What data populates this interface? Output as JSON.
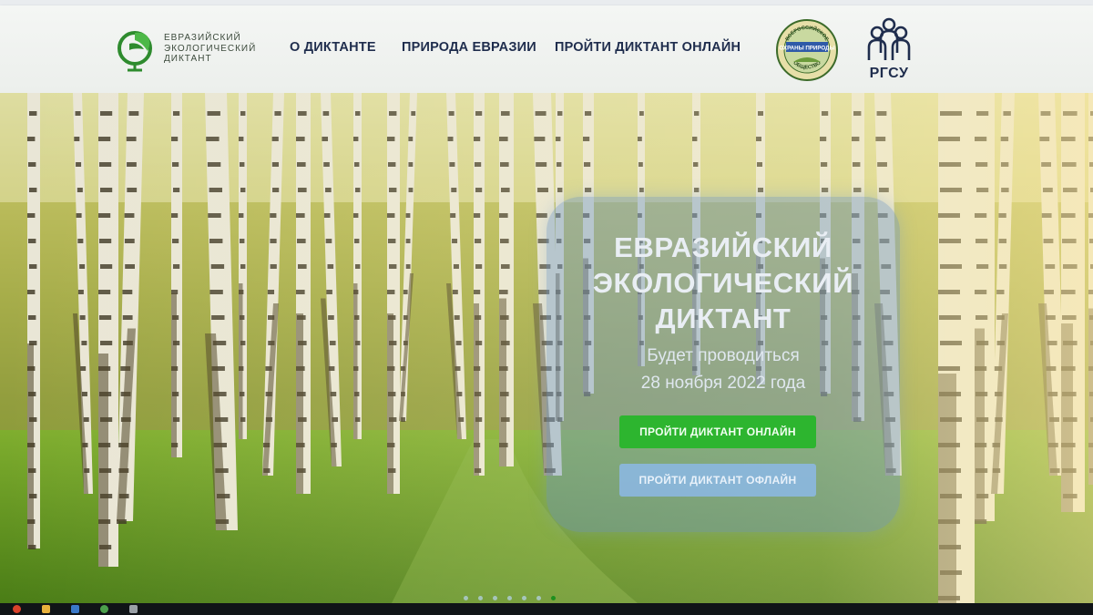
{
  "logo": {
    "lines": [
      "ЕВРАЗИЙСКИЙ",
      "ЭКОЛОГИЧЕСКИЙ",
      "ДИКТАНТ"
    ],
    "color": "#2e8b2e"
  },
  "nav": {
    "items": [
      {
        "label": "О ДИКТАНТЕ"
      },
      {
        "label": "ПРИРОДА ЕВРАЗИИ"
      },
      {
        "label": "ПРОЙТИ ДИКТАНТ ОНЛАЙН"
      }
    ]
  },
  "partners": {
    "seal_text": [
      "ВСЕРОССИЙСКОЕ",
      "ОХРАНЫ ПРИРОДЫ",
      "ОБЩЕСТВО"
    ],
    "rgsu_label": "РГСУ"
  },
  "hero": {
    "title_lines": [
      "ЕВРАЗИЙСКИЙ",
      "ЭКОЛОГИЧЕСКИЙ",
      "ДИКТАНТ"
    ],
    "subtitle_lines": [
      "Будет проводиться",
      "28 ноября 2022 года"
    ],
    "btn_online": "ПРОЙТИ ДИКТАНТ ОНЛАЙН",
    "btn_offline": "ПРОЙТИ ДИКТАНТ ОФЛАЙН",
    "btn_online_color": "#2db52f",
    "dots_total": 7,
    "dots_active_index": 6
  },
  "colors": {
    "nav_text": "#1f2d4d",
    "header_bg": "#eef1ee"
  }
}
